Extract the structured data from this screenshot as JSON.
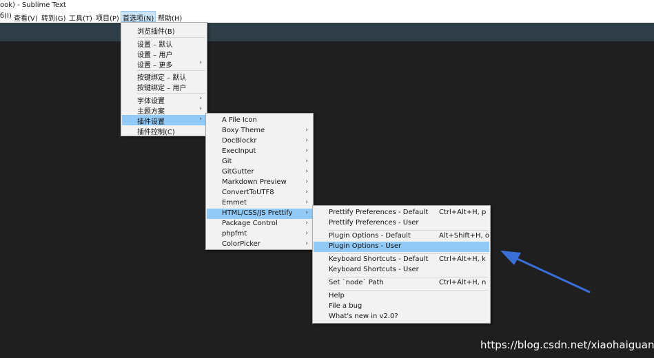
{
  "window": {
    "title": "ook) - Sublime Text"
  },
  "menubar": {
    "items": [
      {
        "label": "б(I)"
      },
      {
        "label": "查看(V)"
      },
      {
        "label": "转到(G)"
      },
      {
        "label": "工具(T)"
      },
      {
        "label": "项目(P)"
      },
      {
        "label": "首选项(N)"
      },
      {
        "label": "帮助(H)"
      }
    ]
  },
  "prefs_menu": {
    "items": [
      {
        "label": "浏览插件(B)"
      },
      {
        "label": "设置 – 默认"
      },
      {
        "label": "设置 – 用户"
      },
      {
        "label": "设置 – 更多"
      },
      {
        "label": "按键绑定 – 默认"
      },
      {
        "label": "按键绑定 – 用户"
      },
      {
        "label": "字体设置"
      },
      {
        "label": "主题方案"
      },
      {
        "label": "插件设置"
      },
      {
        "label": "插件控制(C)"
      }
    ]
  },
  "plugin_menu": {
    "items": [
      {
        "label": "A File Icon"
      },
      {
        "label": "Boxy Theme"
      },
      {
        "label": "DocBlockr"
      },
      {
        "label": "ExecInput"
      },
      {
        "label": "Git"
      },
      {
        "label": "GitGutter"
      },
      {
        "label": "Markdown Preview"
      },
      {
        "label": "ConvertToUTF8"
      },
      {
        "label": "Emmet"
      },
      {
        "label": "HTML/CSS/JS Prettify"
      },
      {
        "label": "Package Control"
      },
      {
        "label": "phpfmt"
      },
      {
        "label": "ColorPicker"
      }
    ]
  },
  "prettify_menu": {
    "items": [
      {
        "label": "Prettify Preferences - Default",
        "shortcut": "Ctrl+Alt+H, p"
      },
      {
        "label": "Prettify Preferences - User",
        "shortcut": ""
      },
      {
        "label": "Plugin Options - Default",
        "shortcut": "Alt+Shift+H, o"
      },
      {
        "label": "Plugin Options - User",
        "shortcut": ""
      },
      {
        "label": "Keyboard Shortcuts - Default",
        "shortcut": "Ctrl+Alt+H, k"
      },
      {
        "label": "Keyboard Shortcuts - User",
        "shortcut": ""
      },
      {
        "label": "Set `node` Path",
        "shortcut": "Ctrl+Alt+H, n"
      },
      {
        "label": "Help",
        "shortcut": ""
      },
      {
        "label": "File a bug",
        "shortcut": ""
      },
      {
        "label": "What's new in v2.0?",
        "shortcut": ""
      }
    ]
  },
  "submenu_arrow": "›",
  "annotation": {
    "color": "#3b6fd8",
    "icon": "pointer-arrow-icon"
  },
  "watermark": "https://blog.csdn.net/xiaohaiguang"
}
